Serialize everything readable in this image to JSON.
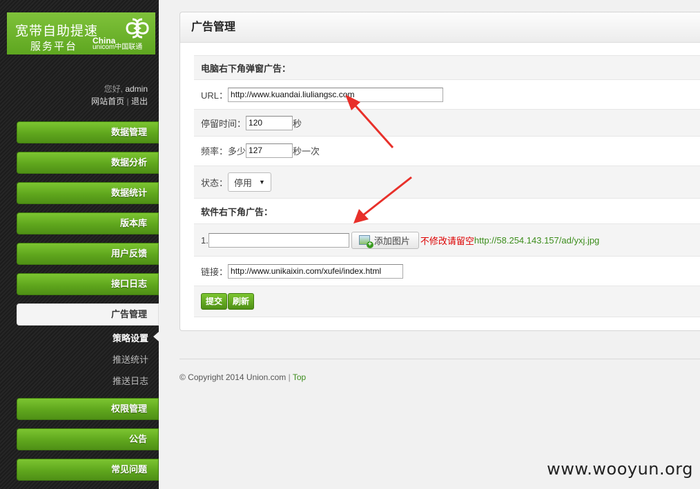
{
  "logo": {
    "line1": "宽带自助提速",
    "line2": "服务平台",
    "brand_top": "China",
    "brand_bottom": "unicom中国联通"
  },
  "greeting": {
    "prefix": "您好,",
    "user": "admin",
    "home_link": "网站首页",
    "separator": "|",
    "logout_link": "退出"
  },
  "sidebar": {
    "items": [
      {
        "label": "数据管理"
      },
      {
        "label": "数据分析"
      },
      {
        "label": "数据统计"
      },
      {
        "label": "版本库"
      },
      {
        "label": "用户反馈"
      },
      {
        "label": "接口日志"
      },
      {
        "label": "广告管理"
      },
      {
        "label": "权限管理"
      },
      {
        "label": "公告"
      },
      {
        "label": "常见问题"
      }
    ],
    "sub_items": [
      {
        "label": "策略设置"
      },
      {
        "label": "推送统计"
      },
      {
        "label": "推送日志"
      }
    ]
  },
  "panel": {
    "title": "广告管理",
    "section1_title": "电脑右下角弹窗广告：",
    "url_label": "URL：",
    "url_value": "http://www.kuandai.liuliangsc.com",
    "stay_label": "停留时间：",
    "stay_value": "120",
    "stay_unit": "秒",
    "freq_label": "频率：多少",
    "freq_value": "127",
    "freq_unit": "秒一次",
    "status_label": "状态：",
    "status_value": "停用",
    "section2_title": "软件右下角广告：",
    "item1_label": "1.",
    "item1_value": "",
    "add_image_button": "添加图片",
    "keep_note": "不修改请留空",
    "image_url": "http://58.254.143.157/ad/yxj.jpg",
    "link_label": "链接：",
    "link_value": "http://www.unikaixin.com/xufei/index.html",
    "submit_button": "提交",
    "refresh_button": "刷新"
  },
  "footer": {
    "copyright": "© Copyright 2014 Union.com",
    "separator": "|",
    "top_link": "Top"
  },
  "watermark": "www.wooyun.org",
  "colors": {
    "accent_green": "#5fa61d",
    "sidebar_bg": "#1f1f1f",
    "annotation_red": "#e8302a"
  }
}
